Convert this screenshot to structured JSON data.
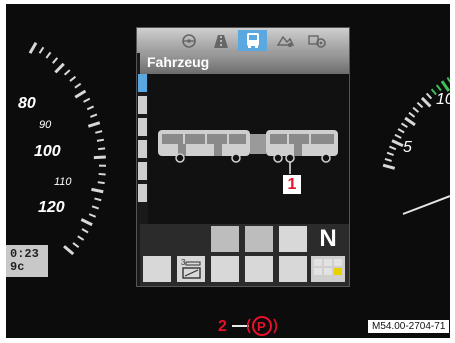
{
  "display": {
    "title": "Fahrzeug",
    "tabs": [
      {
        "icon": "steering-wheel-icon",
        "active": false
      },
      {
        "icon": "road-icon",
        "active": false
      },
      {
        "icon": "bus-icon",
        "active": true
      },
      {
        "icon": "service-icon",
        "active": false
      },
      {
        "icon": "settings-icon",
        "active": false
      }
    ],
    "gear": "N"
  },
  "left_gauge": {
    "labels": [
      "80",
      "90",
      "100",
      "110",
      "120"
    ]
  },
  "right_gauge": {
    "labels": [
      "10",
      "5"
    ]
  },
  "odometer": {
    "line1": "0:23",
    "line2": "9c"
  },
  "callouts": {
    "one": "1",
    "two": "2"
  },
  "parking_brake_symbol": "P",
  "reference_code": "M54.00-2704-71",
  "colors": {
    "active_tab": "#5aa8df",
    "callout_red": "#e8102a",
    "indicator_yellow": "#e8d100",
    "gauge_green": "#3fbf55"
  }
}
